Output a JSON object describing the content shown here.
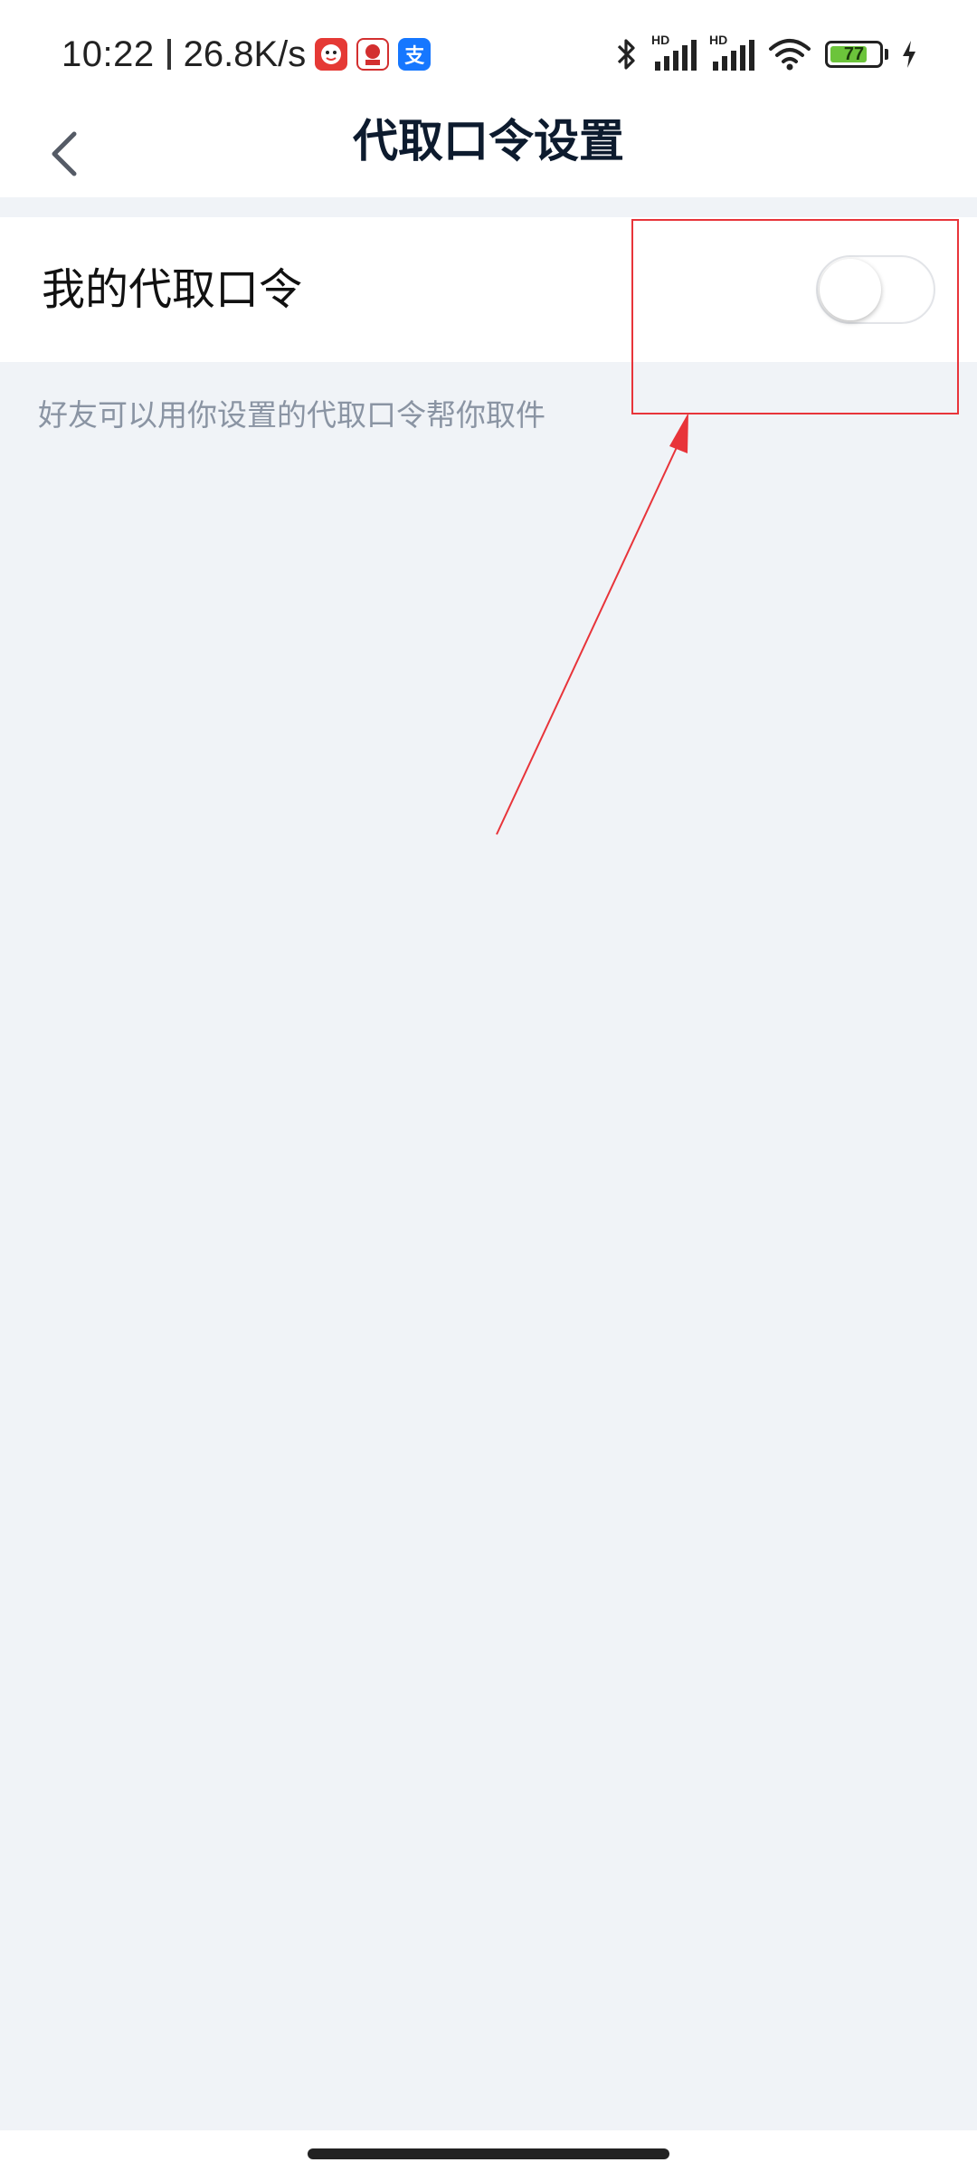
{
  "status_bar": {
    "time": "10:22",
    "network_speed": "26.8K/s",
    "app_icons": [
      "red-mascot-app-icon",
      "618-sale-app-icon",
      "alipay-app-icon"
    ],
    "alipay_glyph": "支",
    "hd_label": "HD",
    "battery_level": "77",
    "battery_fraction": 0.77,
    "battery_color": "#6cc43b"
  },
  "nav": {
    "back_icon": "chevron-left-icon",
    "title": "代取口令设置"
  },
  "setting": {
    "label": "我的代取口令",
    "toggle_on": false,
    "hint": "好友可以用你设置的代取口令帮你取件"
  },
  "annotation": {
    "color": "#e8343a"
  }
}
